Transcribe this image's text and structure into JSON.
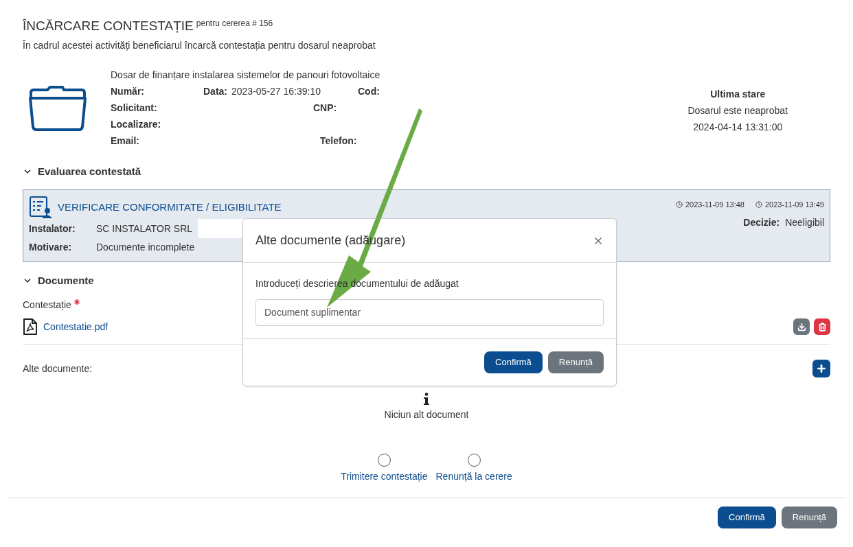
{
  "header": {
    "title": "ÎNCĂRCARE CONTESTAȚIE",
    "title_note": "pentru cererea # 156",
    "description": "În cadrul acestei activități beneficiarul încarcă contestația pentru dosarul  neaprobat"
  },
  "dosar": {
    "title": "Dosar de finanțare instalarea sistemelor de panouri fotovoltaice",
    "rows": [
      [
        {
          "label": "Număr:"
        },
        {
          "label": "Data:",
          "value": "2023-05-27 16:39:10"
        },
        {
          "label": "Cod:"
        }
      ],
      [
        {
          "label": "Solicitant:"
        },
        {
          "label": "CNP:"
        }
      ],
      [
        {
          "label": "Localizare:"
        }
      ],
      [
        {
          "label": "Email:"
        },
        {
          "label": "Telefon:"
        }
      ]
    ]
  },
  "last_state": {
    "title": "Ultima stare",
    "status": "Dosarul este neaprobat",
    "date": "2024-04-14 13:31:00"
  },
  "evaluation": {
    "section": "Evaluarea contestată",
    "expanded": true,
    "title": "VERIFICARE CONFORMITATE / ELIGIBILITATE",
    "times": [
      "2023-11-09 13:48",
      "2023-11-09 13:49"
    ],
    "fields": [
      {
        "label": "Instalator:",
        "value": "SC INSTALATOR SRL"
      },
      {
        "label": "Motivare:",
        "value": "Documente incomplete"
      }
    ],
    "decision": {
      "label": "Decizie:",
      "value": "Neeligibil"
    }
  },
  "documents": {
    "section": "Documente",
    "expanded": true,
    "contestatie_label": "Contestație",
    "required": true,
    "file": "Contestatie.pdf",
    "other_label": "Alte documente:",
    "empty_text": "Niciun alt document"
  },
  "actions": [
    {
      "label": "Trimitere contestație",
      "selected": false
    },
    {
      "label": "Renunță la cerere",
      "selected": false
    }
  ],
  "footer_buttons": [
    {
      "label": "Confirmă",
      "kind": "primary"
    },
    {
      "label": "Renunță",
      "kind": "secondary"
    }
  ],
  "modal": {
    "title": "Alte documente (adăugare)",
    "field_label": "Introduceți descrierea documentului de adăugat",
    "value": "Document suplimentar",
    "buttons": [
      {
        "label": "Confirmă",
        "kind": "primary"
      },
      {
        "label": "Renunță",
        "kind": "secondary"
      }
    ]
  }
}
